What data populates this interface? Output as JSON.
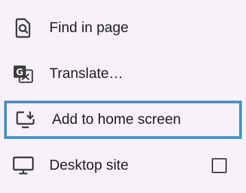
{
  "menu": {
    "items": [
      {
        "label": "Find in page",
        "icon": "find-in-page-icon"
      },
      {
        "label": "Translate…",
        "icon": "translate-icon"
      },
      {
        "label": "Add to home screen",
        "icon": "add-to-home-screen-icon",
        "focused": true
      },
      {
        "label": "Desktop site",
        "icon": "desktop-icon",
        "checkbox_checked": false
      }
    ]
  },
  "colors": {
    "background": "#f7f2fa",
    "text": "#1d1b20",
    "icon": "#3a3a3a",
    "focus_border": "#4a90c2"
  }
}
